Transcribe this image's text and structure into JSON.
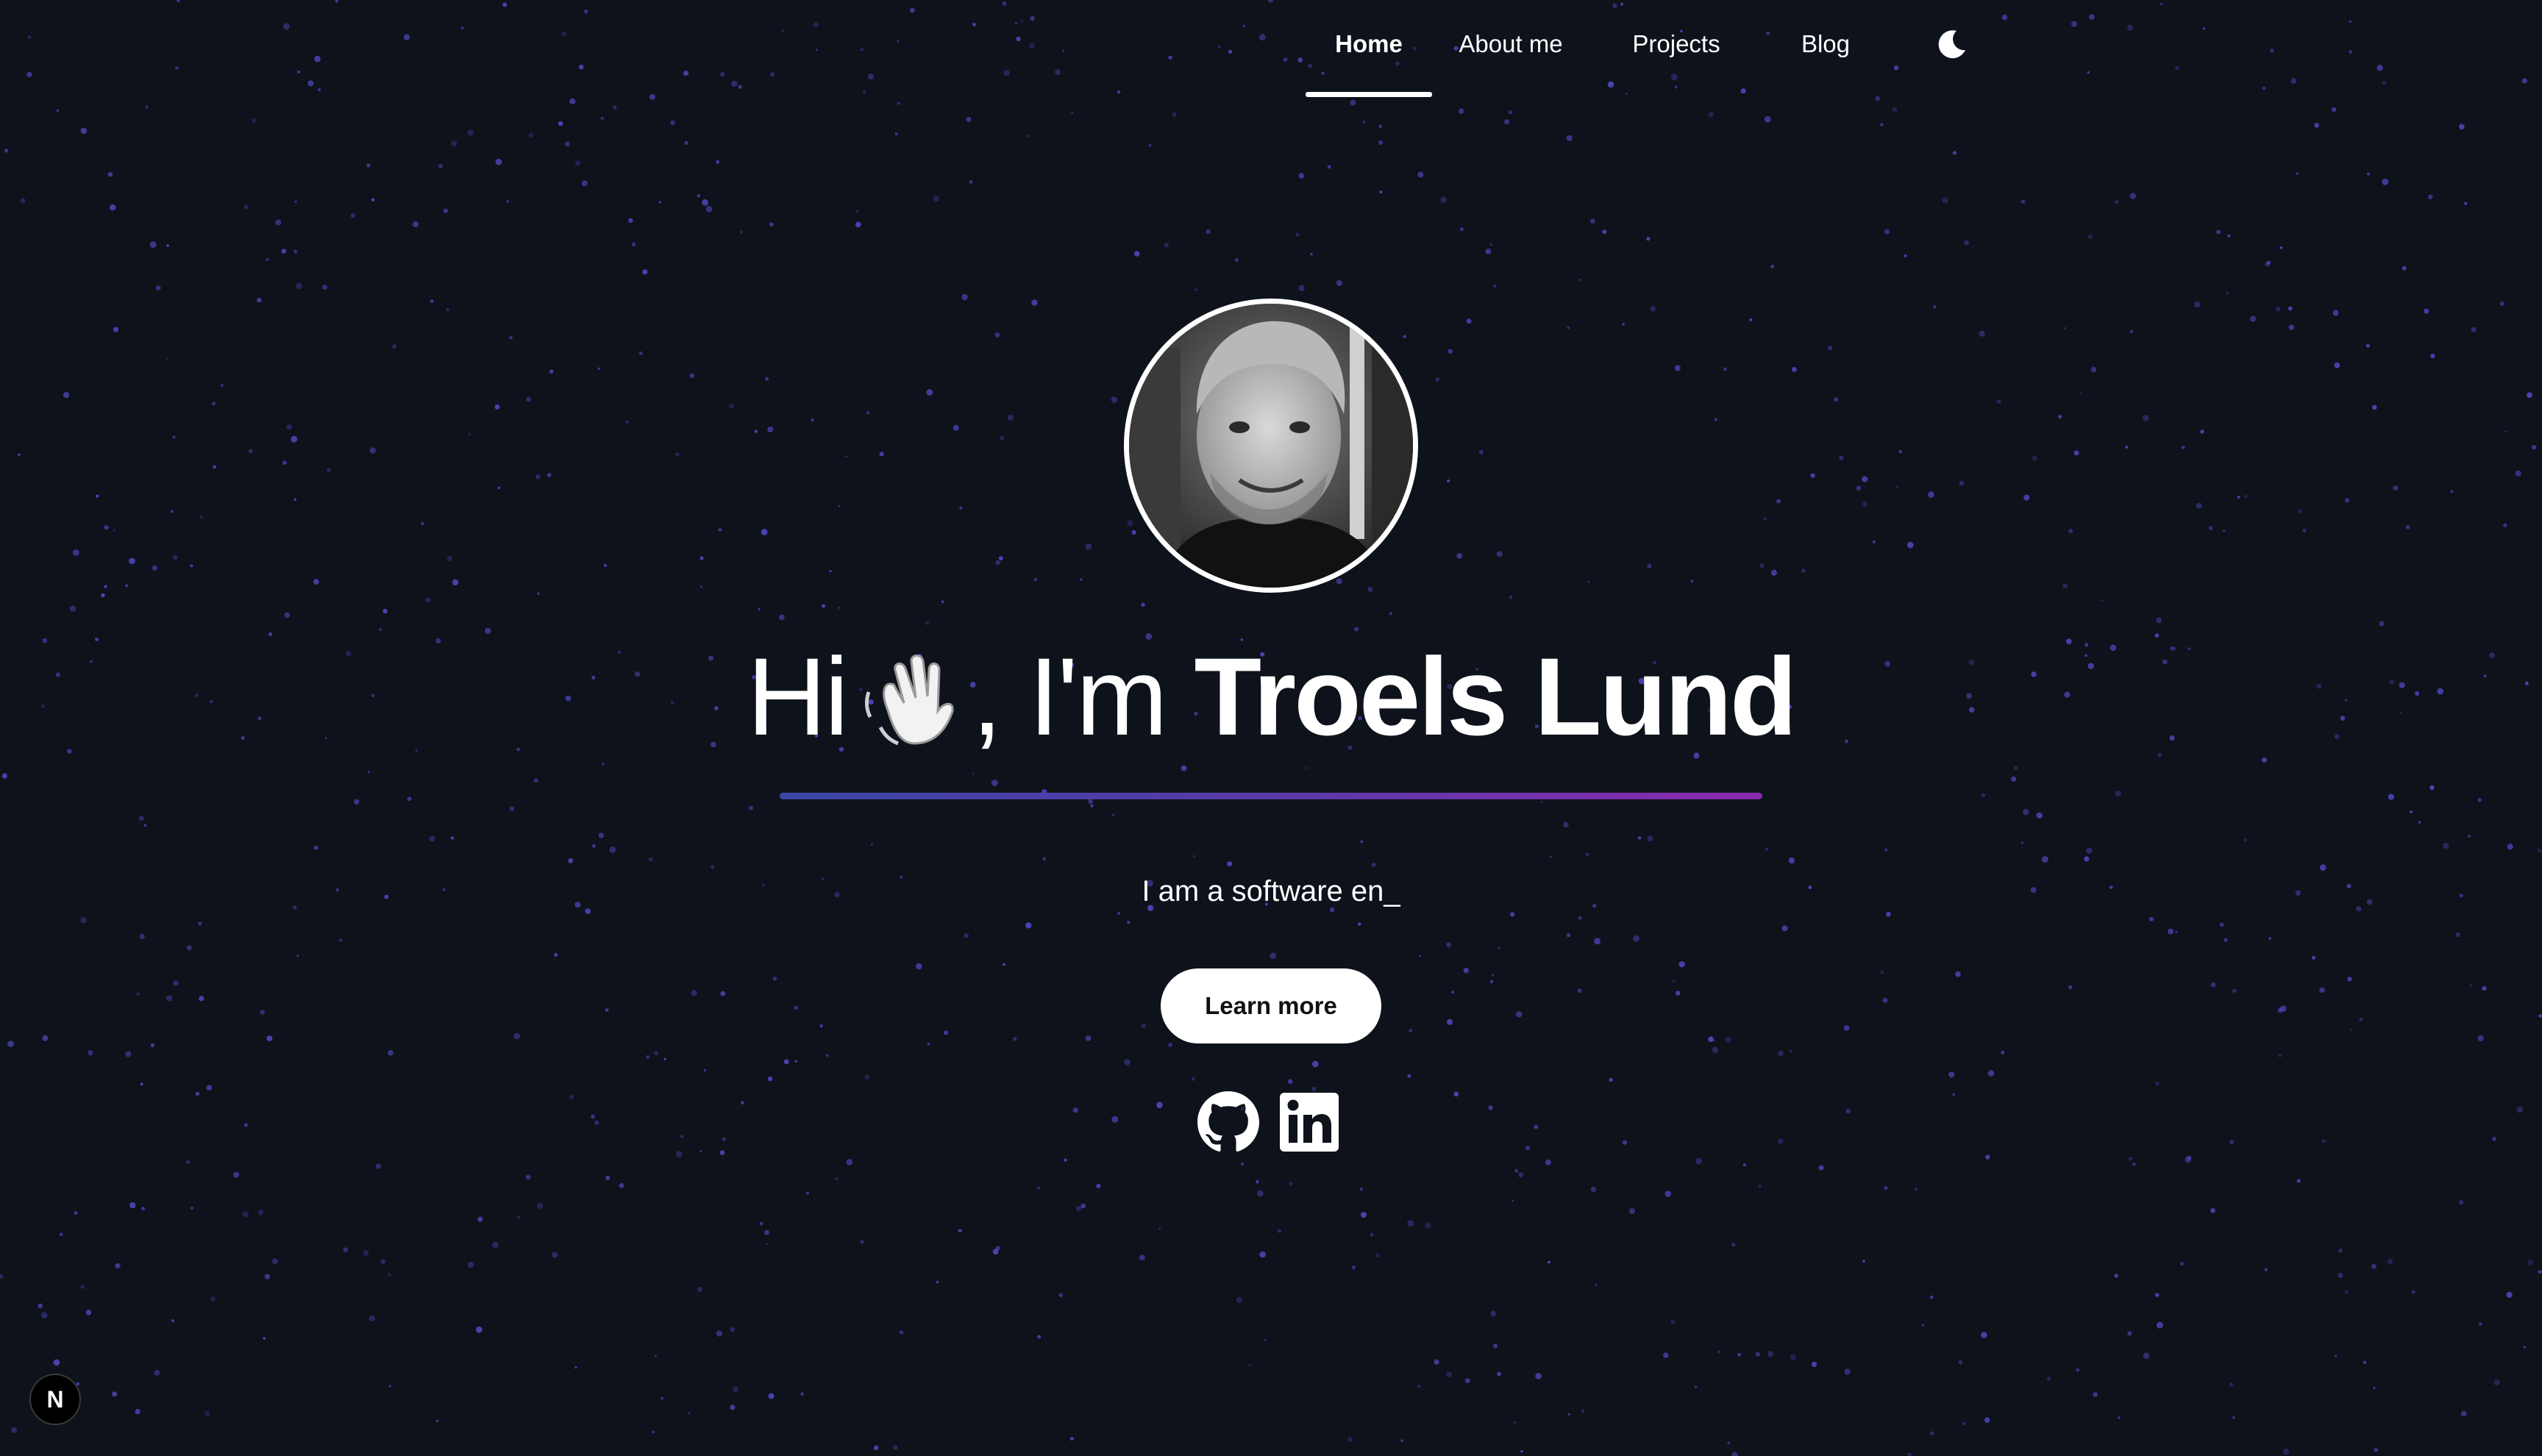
{
  "nav": {
    "items": [
      {
        "label": "Home",
        "active": true
      },
      {
        "label": "About me",
        "active": false
      },
      {
        "label": "Projects",
        "active": false
      },
      {
        "label": "Blog",
        "active": false
      }
    ],
    "theme_toggle_icon": "moon-icon"
  },
  "hero": {
    "avatar_icon": "profile-photo",
    "greeting_prefix": "Hi",
    "greeting_emoji": "waving-hand-icon",
    "greeting_middle": ", I'm",
    "name": "Troels Lund",
    "typed_text": "I am a software en_",
    "cta_label": "Learn more",
    "socials": [
      "github-icon",
      "linkedin-icon"
    ]
  },
  "badge": {
    "label": "N"
  },
  "colors": {
    "background": "#0d121b",
    "star": "#5b4fd6",
    "underline_start": "#3b46a8",
    "underline_end": "#8a2ab0",
    "text": "#ffffff"
  }
}
